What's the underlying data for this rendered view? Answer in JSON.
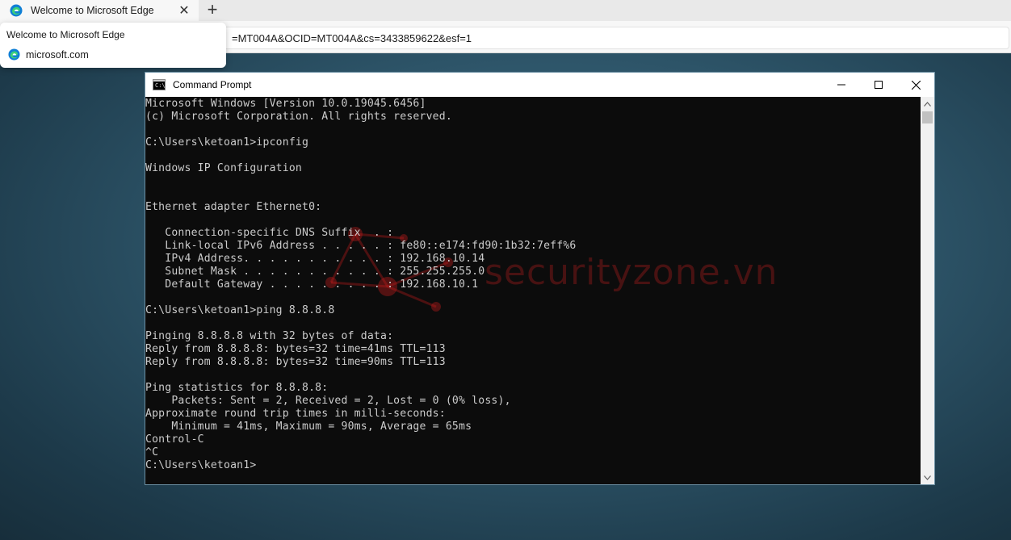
{
  "browser": {
    "tab_title": "Welcome to Microsoft Edge",
    "address": "=MT004A&OCID=MT004A&cs=3433859622&esf=1",
    "hovercard": {
      "title": "Welcome to Microsoft Edge",
      "domain": "microsoft.com"
    }
  },
  "cmd": {
    "title": "Command Prompt",
    "lines": [
      "Microsoft Windows [Version 10.0.19045.6456]",
      "(c) Microsoft Corporation. All rights reserved.",
      "",
      "C:\\Users\\ketoan1>ipconfig",
      "",
      "Windows IP Configuration",
      "",
      "",
      "Ethernet adapter Ethernet0:",
      "",
      "   Connection-specific DNS Suffix  . :",
      "   Link-local IPv6 Address . . . . . : fe80::e174:fd90:1b32:7eff%6",
      "   IPv4 Address. . . . . . . . . . . : 192.168.10.14",
      "   Subnet Mask . . . . . . . . . . . : 255.255.255.0",
      "   Default Gateway . . . . . . . . . : 192.168.10.1",
      "",
      "C:\\Users\\ketoan1>ping 8.8.8.8",
      "",
      "Pinging 8.8.8.8 with 32 bytes of data:",
      "Reply from 8.8.8.8: bytes=32 time=41ms TTL=113",
      "Reply from 8.8.8.8: bytes=32 time=90ms TTL=113",
      "",
      "Ping statistics for 8.8.8.8:",
      "    Packets: Sent = 2, Received = 2, Lost = 0 (0% loss),",
      "Approximate round trip times in milli-seconds:",
      "    Minimum = 41ms, Maximum = 90ms, Average = 65ms",
      "Control-C",
      "^C",
      "C:\\Users\\ketoan1>"
    ],
    "watermark": "securityzone.vn"
  },
  "colors": {
    "console_bg": "#0c0c0c",
    "console_fg": "#cccccc",
    "watermark": "#c81e1e"
  }
}
